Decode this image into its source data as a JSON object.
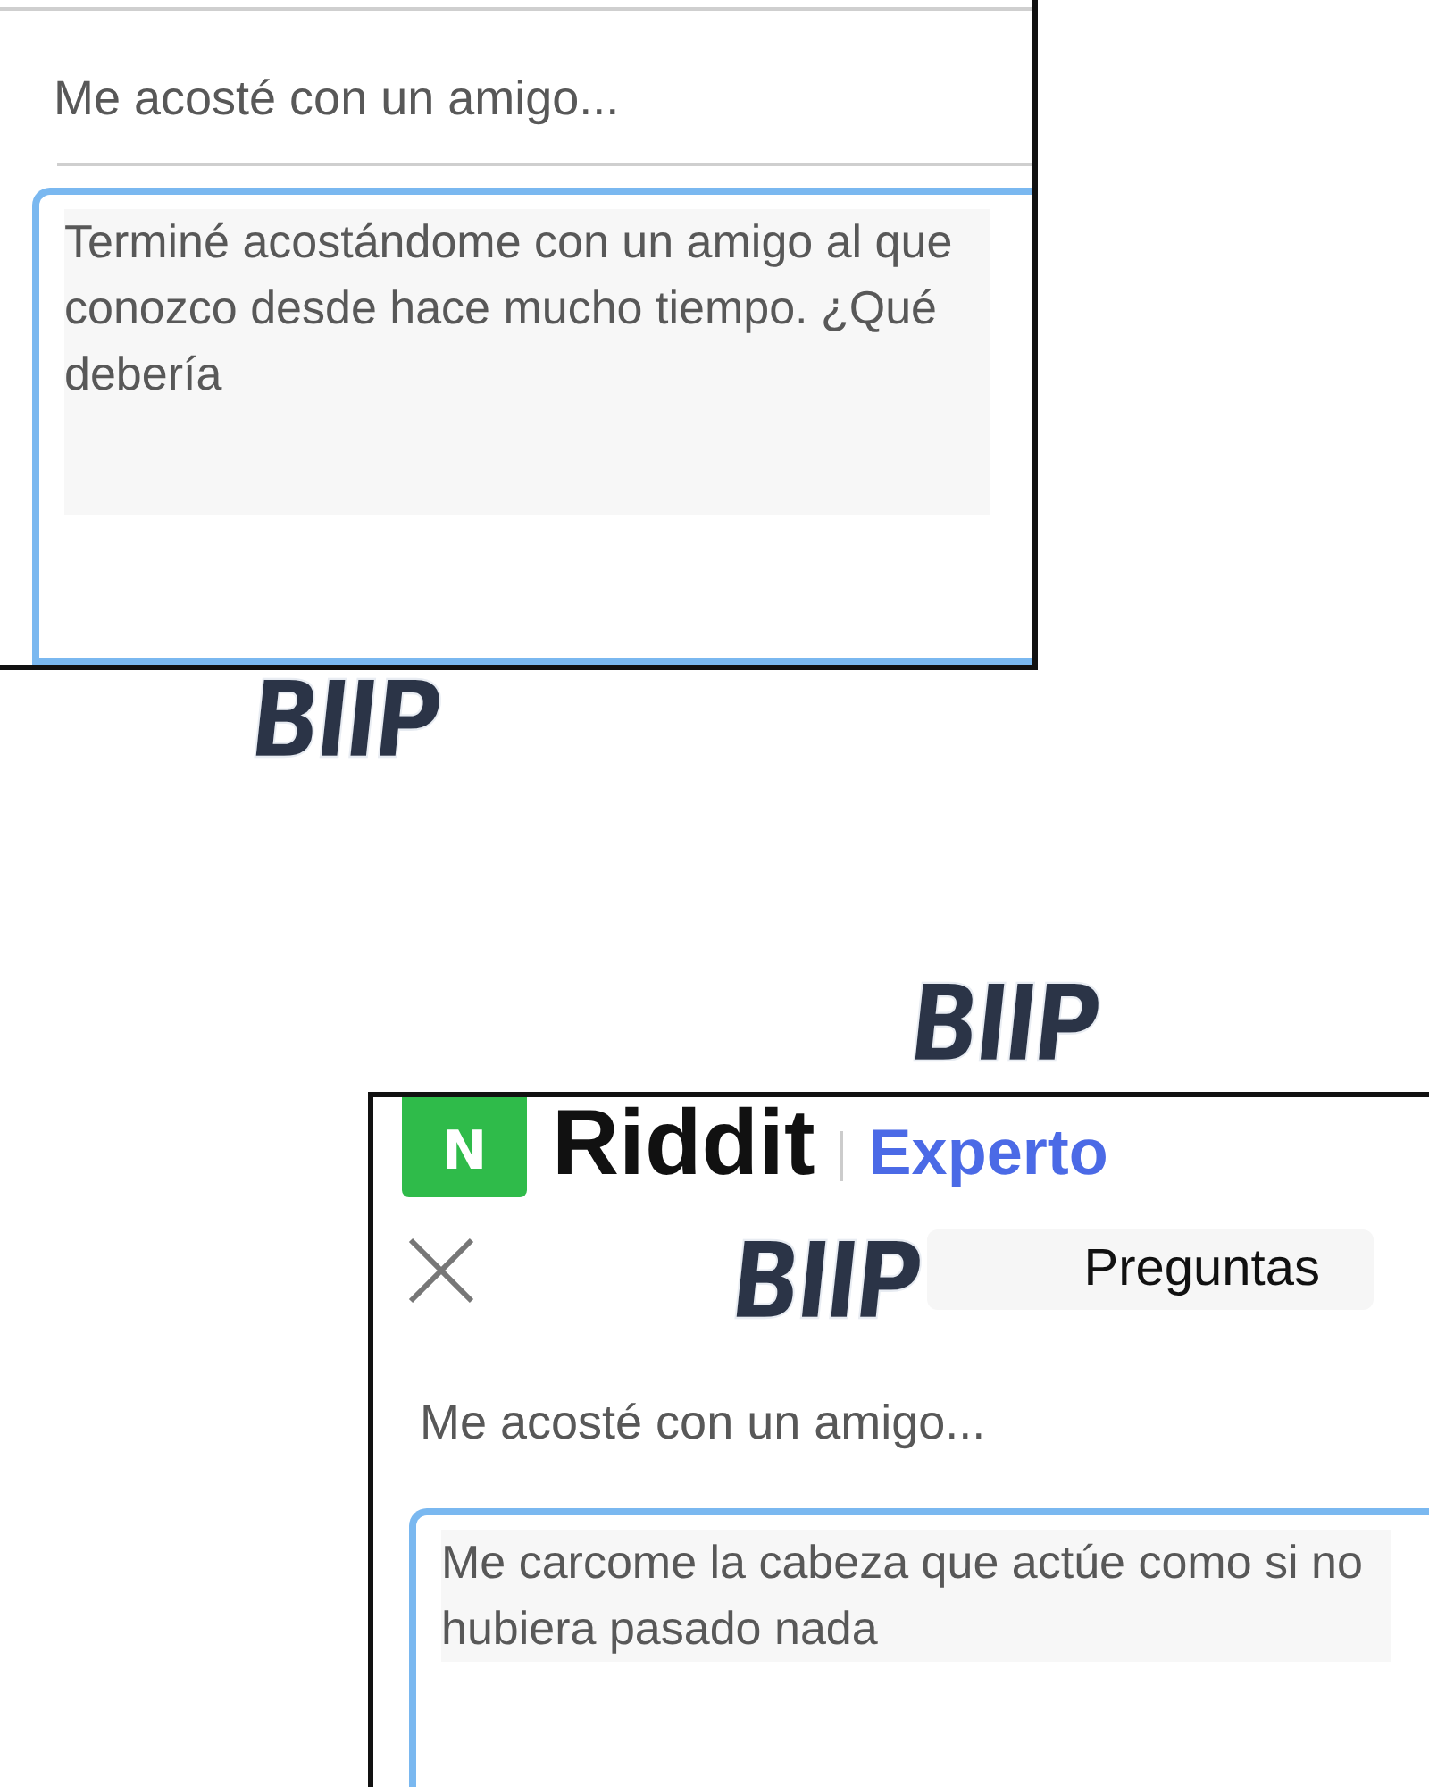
{
  "panels": [
    {
      "question_title": "Me acosté con un amigo...",
      "answer_text": "Terminé acostándome con un amigo al que conozco desde hace mucho tiempo. ¿Qué debería",
      "sfx": [
        "BIIP"
      ]
    },
    {
      "header": {
        "logo": "N",
        "brand": "Riddit",
        "section": "Experto"
      },
      "tab": "Preguntas",
      "question_title": "Me acosté con un amigo...",
      "answer_text": "Me carcome la cabeza que actúe como si no hubiera pasado nada",
      "sfx": [
        "BIIP",
        "BIIP"
      ]
    }
  ]
}
